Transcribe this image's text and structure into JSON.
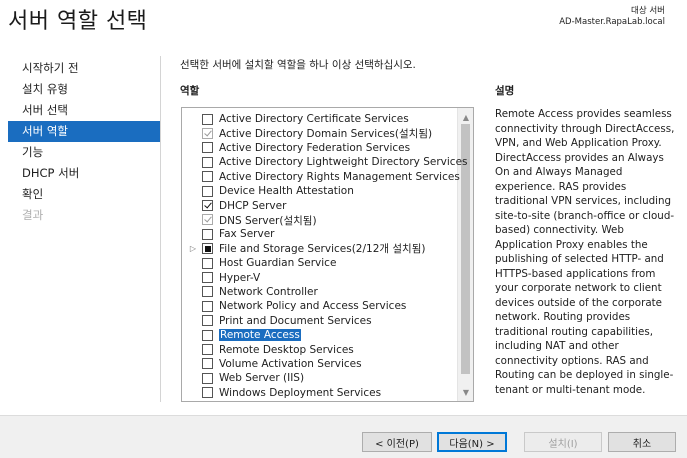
{
  "page": {
    "title": "서버 역할 선택",
    "destination_label": "대상 서버",
    "destination_server": "AD-Master.RapaLab.local"
  },
  "sidebar": {
    "items": [
      {
        "label": "시작하기 전",
        "state": "normal"
      },
      {
        "label": "설치 유형",
        "state": "normal"
      },
      {
        "label": "서버 선택",
        "state": "normal"
      },
      {
        "label": "서버 역할",
        "state": "active"
      },
      {
        "label": "기능",
        "state": "normal"
      },
      {
        "label": "DHCP 서버",
        "state": "normal"
      },
      {
        "label": "확인",
        "state": "normal"
      },
      {
        "label": "결과",
        "state": "disabled"
      }
    ]
  },
  "main": {
    "instruction": "선택한 서버에 설치할 역할을 하나 이상 선택하십시오.",
    "roles_header": "역할",
    "roles": [
      {
        "label": "Active Directory Certificate Services",
        "checked": false
      },
      {
        "label": "Active Directory Domain Services(설치됨)",
        "checked": true,
        "installed": true
      },
      {
        "label": "Active Directory Federation Services",
        "checked": false
      },
      {
        "label": "Active Directory Lightweight Directory Services",
        "checked": false
      },
      {
        "label": "Active Directory Rights Management Services",
        "checked": false
      },
      {
        "label": "Device Health Attestation",
        "checked": false
      },
      {
        "label": "DHCP Server",
        "checked": true
      },
      {
        "label": "DNS Server(설치됨)",
        "checked": true,
        "installed": true
      },
      {
        "label": "Fax Server",
        "checked": false
      },
      {
        "label": "File and Storage Services(2/12개 설치됨)",
        "checked": "partial",
        "expandable": true
      },
      {
        "label": "Host Guardian Service",
        "checked": false
      },
      {
        "label": "Hyper-V",
        "checked": false
      },
      {
        "label": "Network Controller",
        "checked": false
      },
      {
        "label": "Network Policy and Access Services",
        "checked": false
      },
      {
        "label": "Print and Document Services",
        "checked": false
      },
      {
        "label": "Remote Access",
        "checked": false,
        "selected": true
      },
      {
        "label": "Remote Desktop Services",
        "checked": false
      },
      {
        "label": "Volume Activation Services",
        "checked": false
      },
      {
        "label": "Web Server (IIS)",
        "checked": false
      },
      {
        "label": "Windows Deployment Services",
        "checked": false
      }
    ],
    "description_header": "설명",
    "description": "Remote Access provides seamless connectivity through DirectAccess, VPN, and Web Application Proxy. DirectAccess provides an Always On and Always Managed experience. RAS provides traditional VPN services, including site-to-site (branch-office or cloud-based) connectivity. Web Application Proxy enables the publishing of selected HTTP- and HTTPS-based applications from your corporate network to client devices outside of the corporate network. Routing provides traditional routing capabilities, including NAT and other connectivity options. RAS and Routing can be deployed in single-tenant or multi-tenant mode."
  },
  "footer": {
    "prev_label": "< 이전(P)",
    "next_label": "다음(N) >",
    "install_label": "설치(I)",
    "cancel_label": "취소"
  },
  "colors": {
    "accent": "#1a6dc0",
    "footer_bg": "#f0f0f0"
  }
}
